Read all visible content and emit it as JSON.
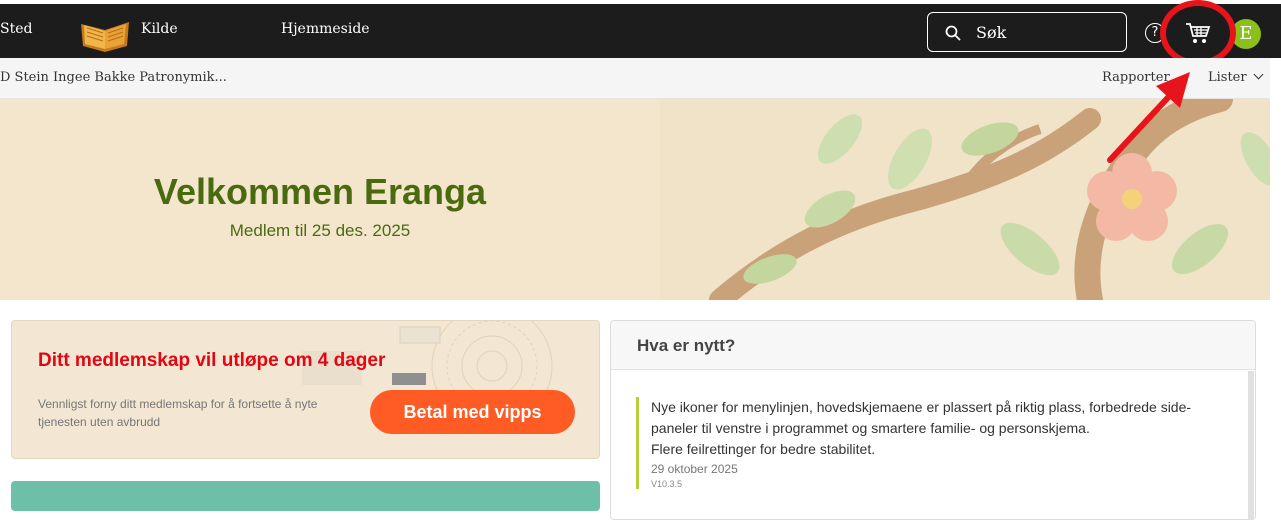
{
  "topbar": {
    "nav_place": "Sted",
    "nav_source": "Kilde",
    "nav_home": "Hjemmeside",
    "search_placeholder": "Søk",
    "help_symbol": "?",
    "avatar_initial": "E"
  },
  "subbar": {
    "breadcrumb": "D Stein Ingee Bakke Patronymik...",
    "reports": "Rapporter",
    "lists": "Lister"
  },
  "hero": {
    "title": "Velkommen Eranga",
    "subtitle": "Medlem til 25 des. 2025"
  },
  "membership": {
    "warning": "Ditt medlemskap vil utløpe om 4 dager",
    "renew_text": "Vennligst forny ditt medlemskap for å fortsette å nyte tjenesten uten avbrudd",
    "pay_button": "Betal med vipps"
  },
  "news": {
    "title": "Hva er nytt?",
    "line1": "Nye ikoner for menylinjen, hovedskjemaene er plassert på riktig plass, forbedrede side-",
    "line2": "paneler til venstre i programmet og smartere familie- og personskjema.",
    "line3": "Flere feilrettinger for bedre stabilitet.",
    "date": "29 oktober 2025",
    "version": "V10.3.5"
  },
  "colors": {
    "topbar": "#1c1c1c",
    "accent_green": "#4a6a10",
    "warning_red": "#e30613",
    "vipps_orange": "#ff5b24",
    "avatar_green": "#8bbf1a",
    "highlight_red": "#e8141b"
  },
  "icons": [
    "book-icon",
    "search-icon",
    "help-icon",
    "cart-icon",
    "chevron-down-icon",
    "arrow-annotation"
  ]
}
